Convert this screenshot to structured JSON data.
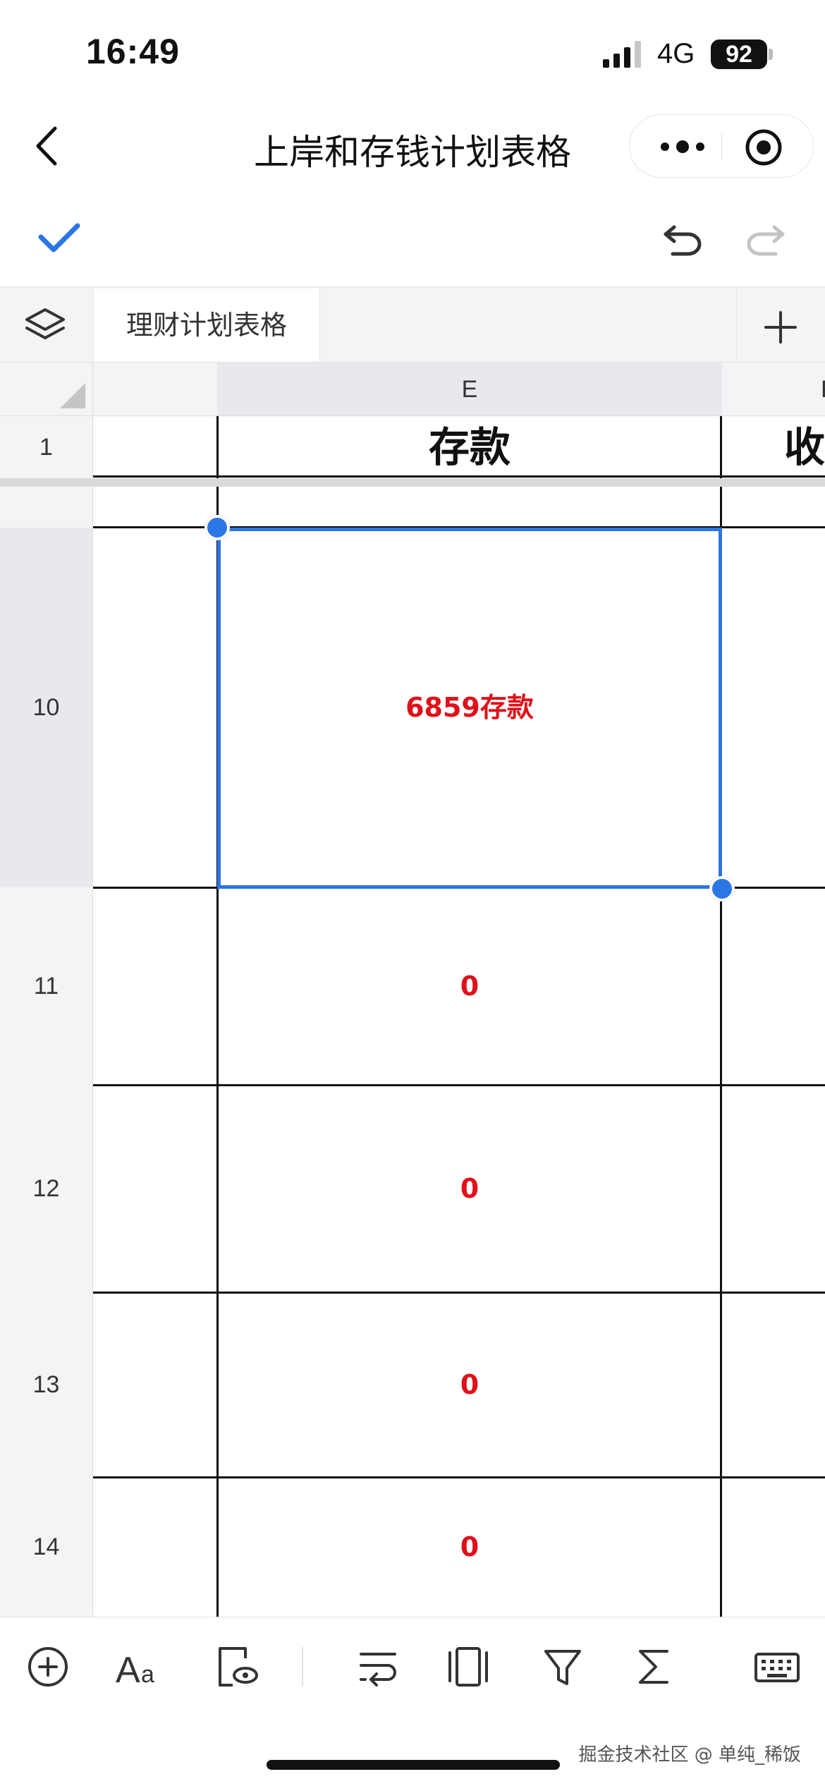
{
  "status_bar": {
    "time": "16:49",
    "network": "4G",
    "battery": "92"
  },
  "nav": {
    "title": "上岸和存钱计划表格"
  },
  "sheet_tabs": {
    "active_tab": "理财计划表格"
  },
  "grid": {
    "columns": [
      "E"
    ],
    "partial_column_letter": "F",
    "header_row_number": "1",
    "header_cells": [
      "存款",
      "收"
    ],
    "rows": [
      {
        "row_number": "10",
        "value": "6859存款",
        "selected": true
      },
      {
        "row_number": "11",
        "value": "0"
      },
      {
        "row_number": "12",
        "value": "0"
      },
      {
        "row_number": "13",
        "value": "0"
      },
      {
        "row_number": "14",
        "value": "0"
      }
    ]
  },
  "colors": {
    "accent": "#2b76e5",
    "value_text": "#e0101a",
    "header_bg": "#f3f4f6"
  },
  "bottom_toolbar": {
    "icons": [
      "insert-icon",
      "text-format-icon",
      "cell-view-icon",
      "wrap-text-icon",
      "freeze-icon",
      "filter-icon",
      "sum-icon",
      "keyboard-icon"
    ]
  },
  "watermark": "掘金技术社区 @ 单纯_稀饭"
}
